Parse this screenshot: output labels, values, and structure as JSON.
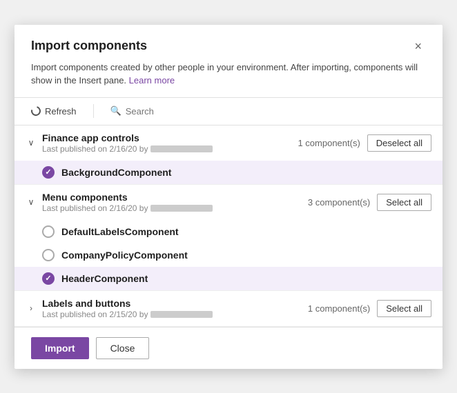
{
  "dialog": {
    "title": "Import components",
    "close_label": "×",
    "description": "Import components created by other people in your environment. After importing, components will show in the Insert pane.",
    "learn_more": "Learn more"
  },
  "toolbar": {
    "refresh_label": "Refresh",
    "search_placeholder": "Search"
  },
  "groups": [
    {
      "id": "finance",
      "name": "Finance app controls",
      "published": "Last published on 2/16/20 by",
      "component_count": "1 component(s)",
      "action_label": "Deselect all",
      "expanded": true,
      "items": [
        {
          "name": "BackgroundComponent",
          "selected": true
        }
      ]
    },
    {
      "id": "menu",
      "name": "Menu components",
      "published": "Last published on 2/16/20 by",
      "component_count": "3 component(s)",
      "action_label": "Select all",
      "expanded": true,
      "items": [
        {
          "name": "DefaultLabelsComponent",
          "selected": false
        },
        {
          "name": "CompanyPolicyComponent",
          "selected": false
        },
        {
          "name": "HeaderComponent",
          "selected": true
        }
      ]
    },
    {
      "id": "labels",
      "name": "Labels and buttons",
      "published": "Last published on 2/15/20 by",
      "component_count": "1 component(s)",
      "action_label": "Select all",
      "expanded": false,
      "items": []
    }
  ],
  "footer": {
    "import_label": "Import",
    "close_label": "Close"
  }
}
